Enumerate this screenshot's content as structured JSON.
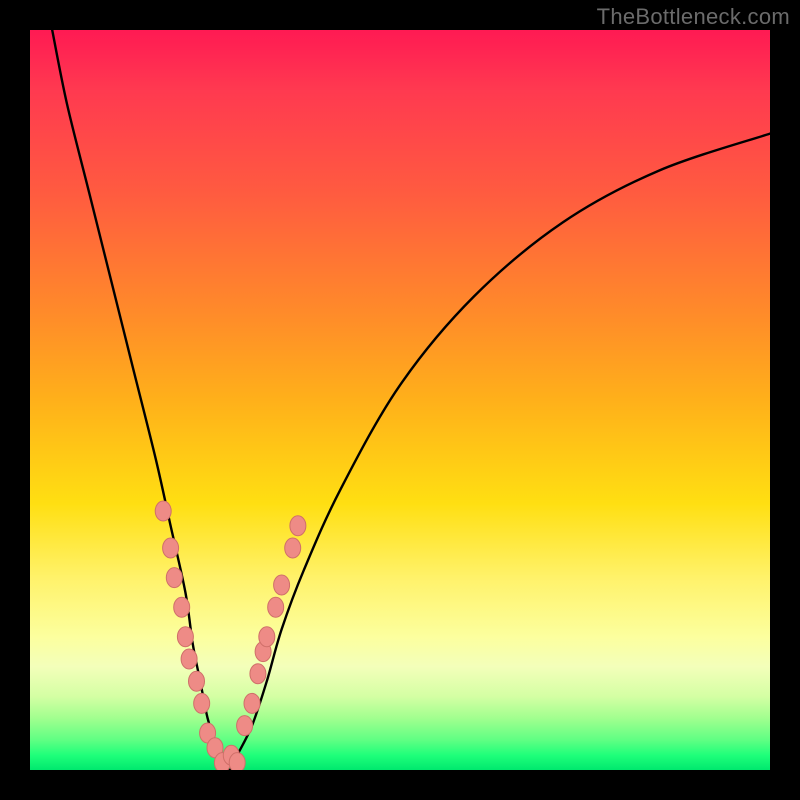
{
  "watermark": "TheBottleneck.com",
  "colors": {
    "frame": "#000000",
    "watermark_text": "#6b6b6b",
    "curve": "#000000",
    "marker_fill": "#ee8b86",
    "marker_stroke": "#cf6f69",
    "gradient_top": "#ff1a53",
    "gradient_bottom": "#00e86e"
  },
  "chart_data": {
    "type": "line",
    "title": "",
    "xlabel": "",
    "ylabel": "",
    "xlim": [
      0,
      100
    ],
    "ylim": [
      0,
      100
    ],
    "grid": false,
    "note": "V-shaped bottleneck curve. x is a normalized performance ratio (0–100); y is bottleneck percentage (0 = no bottleneck at bottom, 100 = severe at top). Values estimated from pixel positions; no axis ticks are shown in the source image.",
    "series": [
      {
        "name": "bottleneck-curve",
        "x": [
          3,
          5,
          8,
          11,
          14,
          17,
          19,
          21,
          22,
          23,
          24,
          25,
          26,
          27,
          28,
          30,
          32,
          34,
          37,
          42,
          50,
          60,
          72,
          85,
          100
        ],
        "y": [
          100,
          90,
          78,
          66,
          54,
          42,
          33,
          24,
          17,
          12,
          7,
          4,
          2,
          0,
          2,
          6,
          12,
          19,
          27,
          38,
          52,
          64,
          74,
          81,
          86
        ]
      }
    ],
    "markers": {
      "name": "highlighted-points",
      "note": "Salmon-colored marker dots clustered near the valley on both arms of the curve; coordinates estimated.",
      "points": [
        {
          "x": 18.0,
          "y": 35
        },
        {
          "x": 19.0,
          "y": 30
        },
        {
          "x": 19.5,
          "y": 26
        },
        {
          "x": 20.5,
          "y": 22
        },
        {
          "x": 21.0,
          "y": 18
        },
        {
          "x": 21.5,
          "y": 15
        },
        {
          "x": 22.5,
          "y": 12
        },
        {
          "x": 23.2,
          "y": 9
        },
        {
          "x": 24.0,
          "y": 5
        },
        {
          "x": 25.0,
          "y": 3
        },
        {
          "x": 26.0,
          "y": 1
        },
        {
          "x": 27.2,
          "y": 2
        },
        {
          "x": 28.0,
          "y": 1
        },
        {
          "x": 29.0,
          "y": 6
        },
        {
          "x": 30.0,
          "y": 9
        },
        {
          "x": 30.8,
          "y": 13
        },
        {
          "x": 31.5,
          "y": 16
        },
        {
          "x": 32.0,
          "y": 18
        },
        {
          "x": 33.2,
          "y": 22
        },
        {
          "x": 34.0,
          "y": 25
        },
        {
          "x": 35.5,
          "y": 30
        },
        {
          "x": 36.2,
          "y": 33
        }
      ]
    }
  }
}
